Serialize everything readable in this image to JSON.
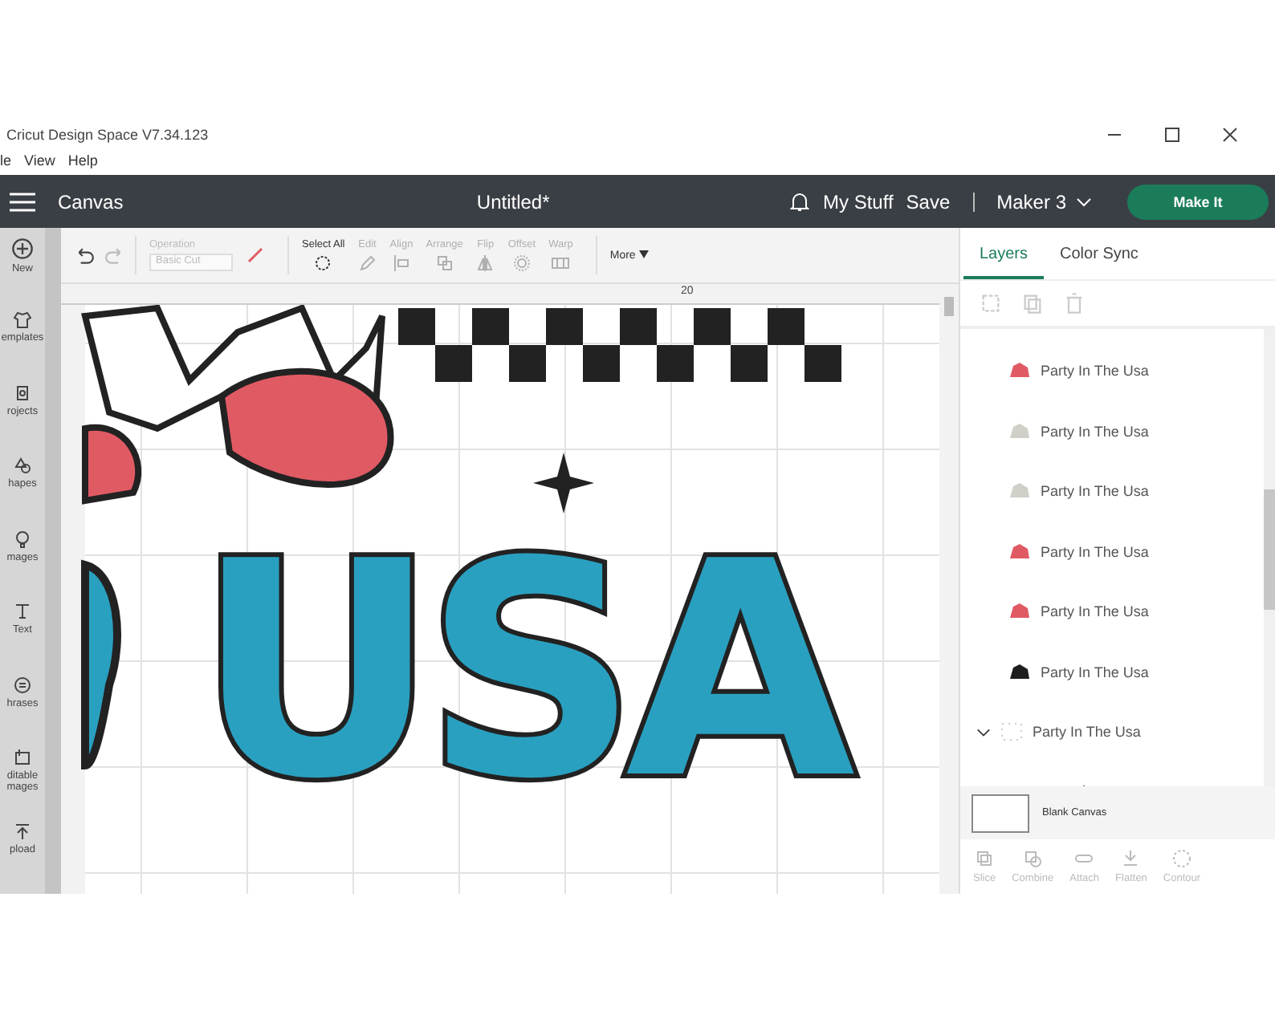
{
  "window": {
    "title": "Cricut Design Space  V7.34.123"
  },
  "menu": [
    "le",
    "View",
    "Help"
  ],
  "header": {
    "section": "Canvas",
    "document": "Untitled*",
    "links": [
      "My Stuff",
      "Save"
    ],
    "machine": "Maker 3",
    "action": "Make It"
  },
  "sidebar": [
    {
      "kind": "new",
      "label": "New"
    },
    {
      "kind": "templates",
      "label": "emplates"
    },
    {
      "kind": "projects",
      "label": "rojects"
    },
    {
      "kind": "shapes",
      "label": "hapes"
    },
    {
      "kind": "images",
      "label": "mages"
    },
    {
      "kind": "text",
      "label": "Text"
    },
    {
      "kind": "phrases",
      "label": "hrases"
    },
    {
      "kind": "editable",
      "label": "ditable\nmages"
    },
    {
      "kind": "upload",
      "label": "pload"
    }
  ],
  "toolbar": {
    "operation": {
      "label": "Operation",
      "value": "Basic Cut"
    },
    "tools": [
      {
        "kind": "select",
        "label": "Select All",
        "disabled": false
      },
      {
        "kind": "edit",
        "label": "Edit",
        "disabled": true
      },
      {
        "kind": "align",
        "label": "Align",
        "disabled": true
      },
      {
        "kind": "arrange",
        "label": "Arrange",
        "disabled": true
      },
      {
        "kind": "flip",
        "label": "Flip",
        "disabled": true
      },
      {
        "kind": "offset",
        "label": "Offset",
        "disabled": true
      },
      {
        "kind": "warp",
        "label": "Warp",
        "disabled": true
      }
    ],
    "more": "More"
  },
  "canvas": {
    "ruler_mark": "20",
    "text": "USA"
  },
  "panel": {
    "tabs": [
      {
        "label": "Layers",
        "selected": true
      },
      {
        "label": "Color Sync",
        "selected": false
      }
    ],
    "layers": [
      {
        "kind": "shape",
        "name": "Party In The Usa",
        "color": "#e05a64"
      },
      {
        "kind": "shape",
        "name": "Party In The Usa",
        "color": "#d0d0c8"
      },
      {
        "kind": "shape",
        "name": "Party In The Usa",
        "color": "#d0d0c8"
      },
      {
        "kind": "shape",
        "name": "Party In The Usa",
        "color": "#e05a64"
      },
      {
        "kind": "shape",
        "name": "Party In The Usa",
        "color": "#e05a64"
      },
      {
        "kind": "shape",
        "name": "Party In The Usa",
        "color": "#1e1e1e"
      },
      {
        "kind": "group",
        "name": "Party In The Usa",
        "color": "#cccccc",
        "expanded": true
      }
    ],
    "canvas_label": "Blank Canvas",
    "actions": [
      {
        "kind": "slice",
        "label": "Slice"
      },
      {
        "kind": "combine",
        "label": "Combine"
      },
      {
        "kind": "attach",
        "label": "Attach"
      },
      {
        "kind": "flatten",
        "label": "Flatten"
      },
      {
        "kind": "contour",
        "label": "Contour"
      }
    ]
  }
}
